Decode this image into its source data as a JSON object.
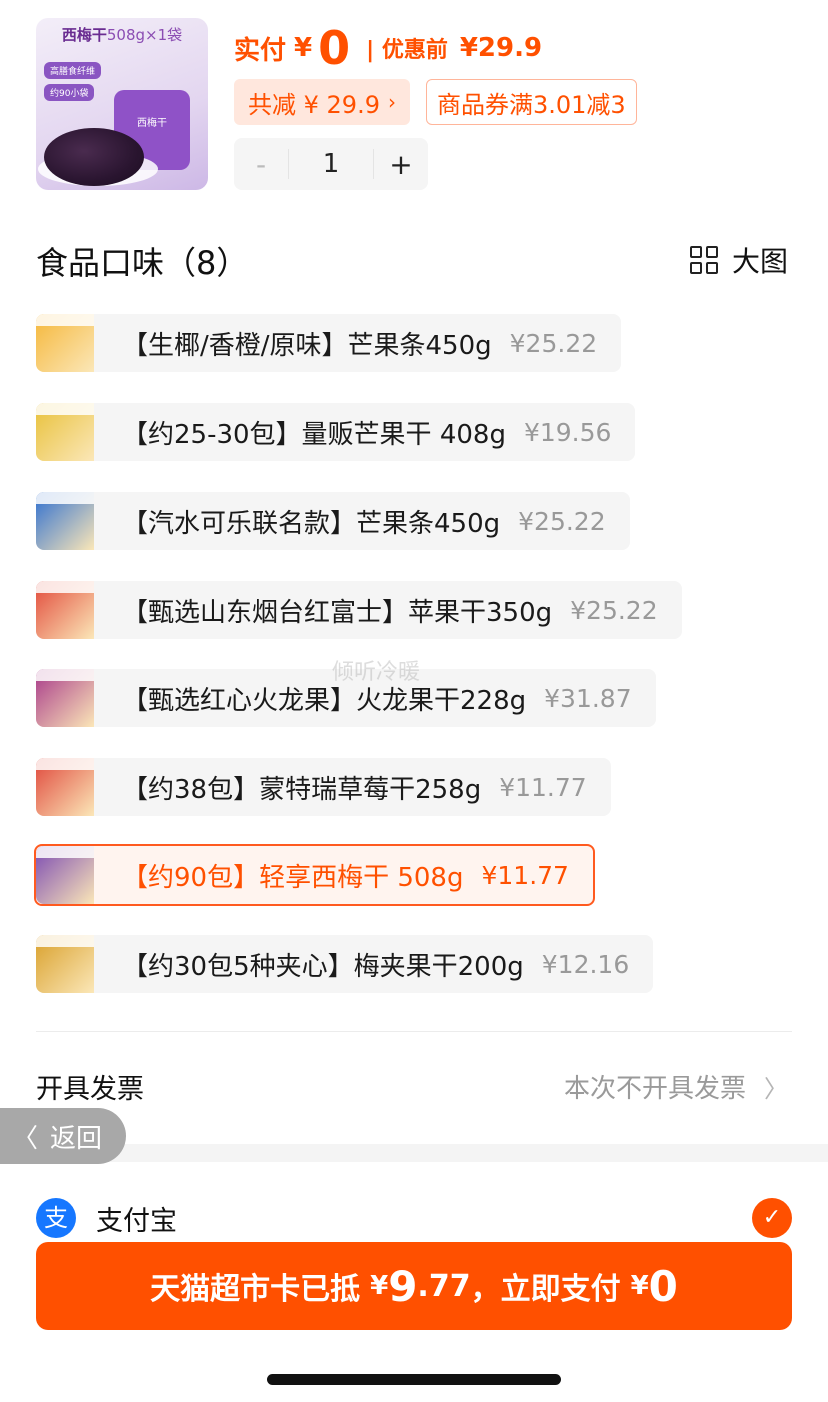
{
  "product": {
    "thumb_title": "西梅干",
    "thumb_subtitle": "508g×1袋",
    "thumb_tags": [
      "高膳食纤维",
      "约90小袋"
    ],
    "thumb_brand": "西梅干",
    "paid_label": "实付",
    "currency": "¥",
    "paid_amount": "0",
    "original_label": "| 优惠前",
    "original_price": "¥29.9",
    "discount_text": "共减 ¥ 29.9",
    "coupon_text": "商品券满3.01减3",
    "quantity": "1",
    "minus": "-",
    "plus": "+"
  },
  "flavors": {
    "title": "食品口味（8）",
    "view_label": "大图",
    "options": [
      {
        "name": "【生椰/香橙/原味】芒果条450g",
        "price": "¥25.22",
        "selected": false,
        "color": "#f5b73a"
      },
      {
        "name": "【约25-30包】量贩芒果干 408g",
        "price": "¥19.56",
        "selected": false,
        "color": "#e8c13a"
      },
      {
        "name": "【汽水可乐联名款】芒果条450g",
        "price": "¥25.22",
        "selected": false,
        "color": "#2f6fd0"
      },
      {
        "name": "【甄选山东烟台红富士】苹果干350g",
        "price": "¥25.22",
        "selected": false,
        "color": "#e24a3b"
      },
      {
        "name": "【甄选红心火龙果】火龙果干228g",
        "price": "¥31.87",
        "selected": false,
        "color": "#a83a8a"
      },
      {
        "name": "【约38包】蒙特瑞草莓干258g",
        "price": "¥11.77",
        "selected": false,
        "color": "#e0483c"
      },
      {
        "name": "【约90包】轻享西梅干 508g",
        "price": "¥11.77",
        "selected": true,
        "color": "#7c4bb3"
      },
      {
        "name": "【约30包5种夹心】梅夹果干200g",
        "price": "¥12.16",
        "selected": false,
        "color": "#d9a02b"
      }
    ]
  },
  "invoice": {
    "label": "开具发票",
    "value": "本次不开具发票"
  },
  "back": {
    "label": "返回"
  },
  "payment": {
    "method": "支付宝",
    "icon_char": "支"
  },
  "pay_button": {
    "prefix": "天猫超市卡已抵",
    "card_yen": "¥",
    "card_int": "9",
    "card_dec": ".77",
    "middle": "，立即支付",
    "pay_yen": "¥",
    "pay_amount": "0"
  },
  "watermark": "倾听冷暖",
  "colors": {
    "accent": "#ff5000",
    "alipay": "#1677ff"
  }
}
